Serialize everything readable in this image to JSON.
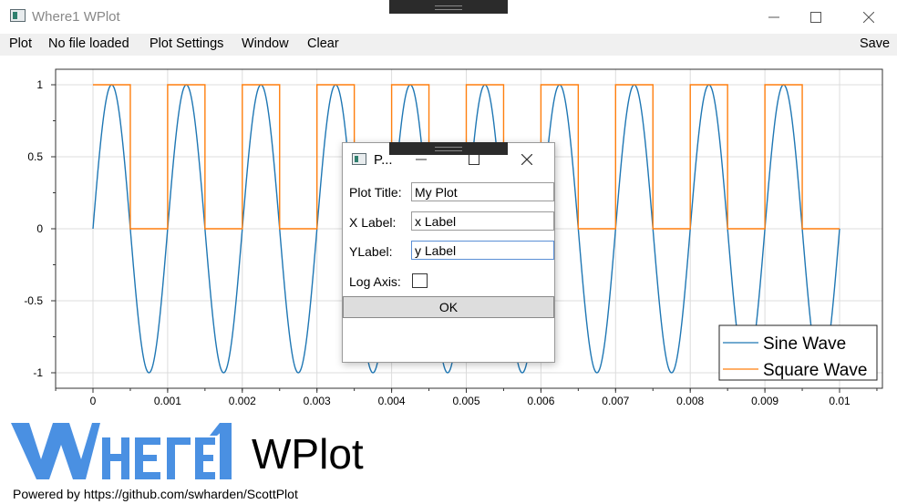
{
  "window": {
    "title": "Where1 WPlot",
    "controls": {
      "minimize": "—",
      "maximize": "☐",
      "close": "✕"
    }
  },
  "menu": {
    "items": [
      "Plot",
      "No file loaded",
      "Plot Settings",
      "Window",
      "Clear"
    ],
    "save": "Save"
  },
  "chart_data": {
    "type": "line",
    "title": "",
    "xlabel": "",
    "ylabel": "",
    "xlim": [
      0,
      0.01
    ],
    "ylim": [
      -1,
      1
    ],
    "grid": true,
    "legend_position": "bottom-right",
    "x_tick_labels": [
      "0",
      "0.001",
      "0.002",
      "0.003",
      "0.004",
      "0.005",
      "0.006",
      "0.007",
      "0.008",
      "0.009",
      "0.01"
    ],
    "y_tick_labels": [
      "1",
      "0.5",
      "0",
      "-0.5",
      "-1"
    ],
    "series": [
      {
        "name": "Sine Wave",
        "color": "#1f77b4",
        "function": "sin(2*pi*1000*x)",
        "frequency_hz": 1000,
        "amplitude": 1
      },
      {
        "name": "Square Wave",
        "color": "#ff7f0e",
        "function": "square",
        "frequency_hz": 1000,
        "high": 1,
        "low": 0,
        "duty_cycle": 0.5
      }
    ]
  },
  "logo": {
    "text": "Where1"
  },
  "app_name": "WPlot",
  "footer": "Powered by https://github.com/swharden/ScottPlot",
  "dialog": {
    "title": "P...",
    "plot_title_label": "Plot Title:",
    "plot_title_value": "My Plot",
    "x_label_label": "X Label:",
    "x_label_value": "x Label",
    "y_label_label": "YLabel:",
    "y_label_value": "y Label",
    "log_axis_label": "Log Axis:",
    "log_axis_checked": false,
    "ok_label": "OK"
  }
}
